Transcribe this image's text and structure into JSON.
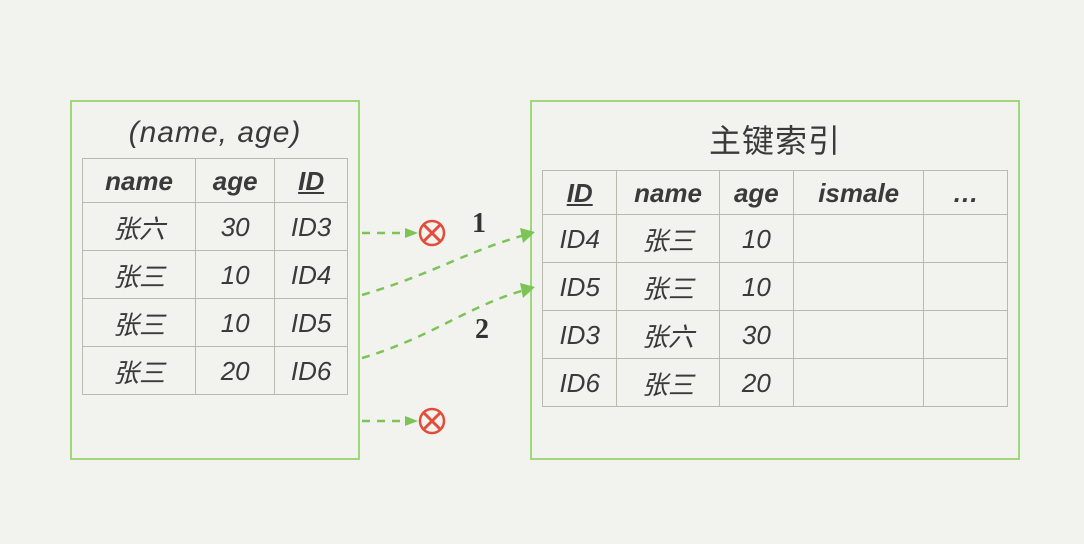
{
  "left": {
    "title": "(name, age)",
    "headers": {
      "h1": "name",
      "h2": "age",
      "h3": "ID"
    },
    "rows": [
      {
        "name": "张六",
        "age": "30",
        "id": "ID3"
      },
      {
        "name": "张三",
        "age": "10",
        "id": "ID4"
      },
      {
        "name": "张三",
        "age": "10",
        "id": "ID5"
      },
      {
        "name": "张三",
        "age": "20",
        "id": "ID6"
      }
    ]
  },
  "right": {
    "title": "主键索引",
    "headers": {
      "h1": "ID",
      "h2": "name",
      "h3": "age",
      "h4": "ismale",
      "h5": "…"
    },
    "rows": [
      {
        "id": "ID4",
        "name": "张三",
        "age": "10",
        "ismale": "",
        "more": ""
      },
      {
        "id": "ID5",
        "name": "张三",
        "age": "10",
        "ismale": "",
        "more": ""
      },
      {
        "id": "ID3",
        "name": "张六",
        "age": "30",
        "ismale": "",
        "more": ""
      },
      {
        "id": "ID6",
        "name": "张三",
        "age": "20",
        "ismale": "",
        "more": ""
      }
    ]
  },
  "arrows": {
    "label1": "1",
    "label2": "2"
  }
}
